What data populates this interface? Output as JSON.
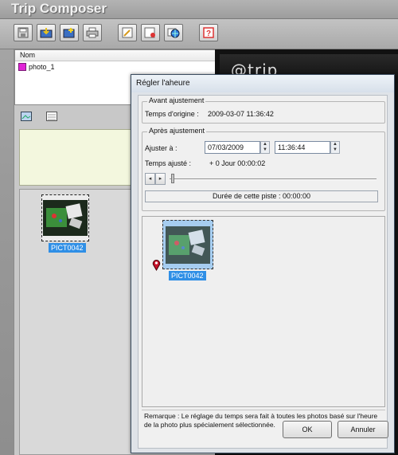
{
  "app": {
    "title": "Trip Composer",
    "list_header": "Nom",
    "list_items": [
      {
        "name": "photo_1",
        "color": "#e023d6"
      }
    ],
    "brand": "@trip",
    "thumbnail_label": "PICT0042"
  },
  "toolbar": {
    "buttons": [
      "save-icon",
      "import-icon",
      "add-photo-icon",
      "print-icon",
      "edit-icon",
      "tag-icon",
      "globe-icon",
      "help-icon"
    ]
  },
  "dialog": {
    "title": "Régler l'aheure",
    "before_group": "Avant ajustement",
    "original_time_label": "Temps d'origine :",
    "original_time_value": "2009-03-07 11:36:42",
    "after_group": "Après ajustement",
    "adjust_label": "Ajuster à :",
    "adjust_date": "07/03/2009",
    "adjust_time": "11:36:44",
    "adjusted_time_label": "Temps ajusté :",
    "adjusted_time_value": "+ 0 Jour   00:00:02",
    "duration_label": "Durée de cette piste :",
    "duration_value": "00:00:00",
    "photo_label": "PICT0042",
    "remark_line1": "Remarque : Le réglage du temps sera fait à toutes les photos basé sur l'heure",
    "remark_line2": "de la photo plus spécialement sélectionnée.",
    "ok_label": "OK",
    "cancel_label": "Annuler"
  },
  "colors": {
    "selection": "#2f8fe6",
    "accent_track": "#e023d6"
  }
}
